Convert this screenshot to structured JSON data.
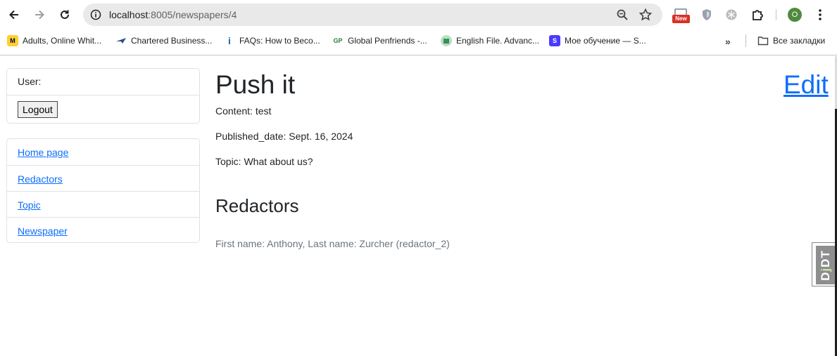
{
  "browser": {
    "url_host": "localhost",
    "url_path": ":8005/newspapers/4",
    "new_badge": "New",
    "profile_initial": "O",
    "bookmarks": [
      {
        "label": "Adults, Online Whit...",
        "icon": "miro-icon"
      },
      {
        "label": "Chartered Business...",
        "icon": "plane-icon"
      },
      {
        "label": "FAQs: How to Beco...",
        "icon": "info-icon"
      },
      {
        "label": "Global Penfriends -...",
        "icon": "gp-icon"
      },
      {
        "label": "English File. Advanc...",
        "icon": "book-icon"
      },
      {
        "label": "Мое обучение — S...",
        "icon": "s-icon"
      }
    ],
    "bookmarks_more": "»",
    "all_bookmarks": "Все закладки"
  },
  "sidebar": {
    "user_label": "User:",
    "logout_label": "Logout",
    "nav": [
      {
        "label": "Home page"
      },
      {
        "label": "Redactors"
      },
      {
        "label": "Topic"
      },
      {
        "label": "Newspaper"
      }
    ]
  },
  "newspaper": {
    "title": "Push it",
    "edit_label": "Edit",
    "content": "Content: test",
    "published_date": "Published_date: Sept. 16, 2024",
    "topic": "Topic: What about us?",
    "redactors_heading": "Redactors",
    "redactors": [
      {
        "text": "First name: Anthony, Last name: Zurcher (redactor_2)"
      }
    ]
  },
  "debug_toolbar": {
    "label_d": "D",
    "label_j": "j",
    "label_dt": "DT"
  },
  "colors": {
    "link": "#0d6efd",
    "text": "#212529",
    "muted": "#6c757d",
    "border": "#dee2e6"
  }
}
